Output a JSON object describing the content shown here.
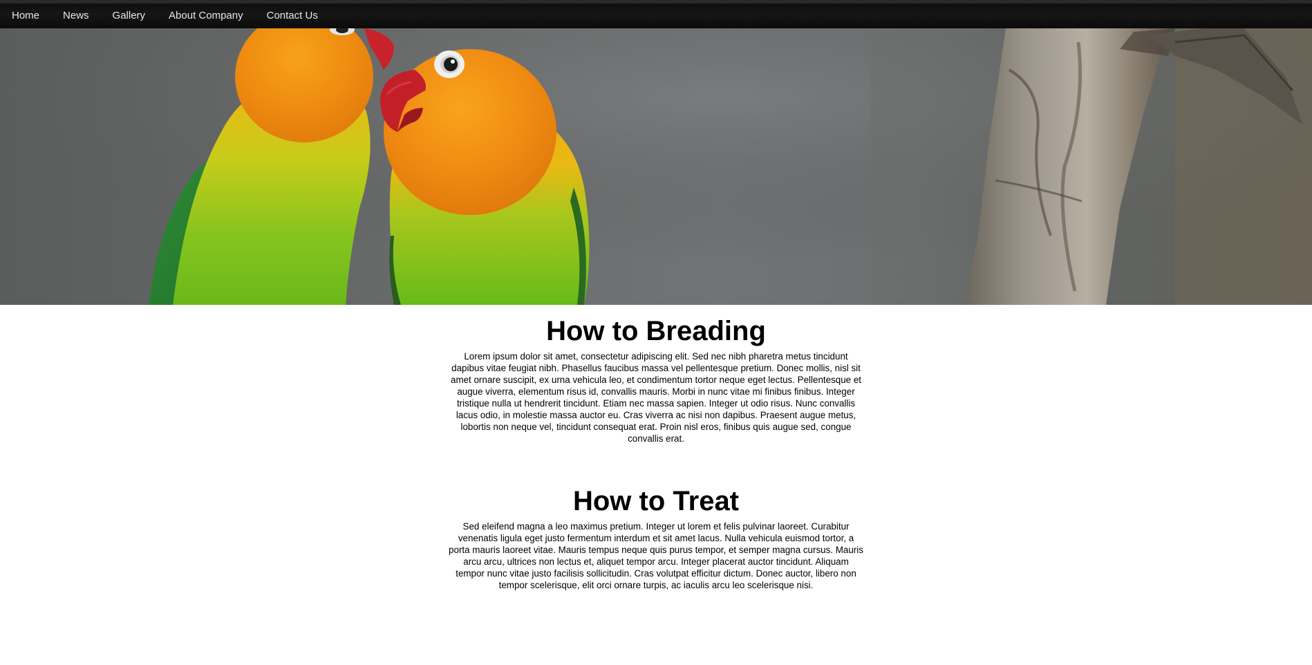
{
  "nav": {
    "items": [
      {
        "label": "Home"
      },
      {
        "label": "News"
      },
      {
        "label": "Gallery"
      },
      {
        "label": "About Company"
      },
      {
        "label": "Contact Us"
      }
    ]
  },
  "hero": {
    "image": "parrots-photo"
  },
  "sections": [
    {
      "title": "How to Breading",
      "body": "Lorem ipsum dolor sit amet, consectetur adipiscing elit. Sed nec nibh pharetra metus tincidunt dapibus vitae feugiat nibh. Phasellus faucibus massa vel pellentesque pretium. Donec mollis, nisl sit amet ornare suscipit, ex urna vehicula leo, et condimentum tortor neque eget lectus. Pellentesque et augue viverra, elementum risus id, convallis mauris. Morbi in nunc vitae mi finibus finibus. Integer tristique nulla ut hendrerit tincidunt. Etiam nec massa sapien. Integer ut odio risus. Nunc convallis lacus odio, in molestie massa auctor eu. Cras viverra ac nisi non dapibus. Praesent augue metus, lobortis non neque vel, tincidunt consequat erat. Proin nisl eros, finibus quis augue sed, congue convallis erat."
    },
    {
      "title": "How to Treat",
      "body": "Sed eleifend magna a leo maximus pretium. Integer ut lorem et felis pulvinar laoreet. Curabitur venenatis ligula eget justo fermentum interdum et sit amet lacus. Nulla vehicula euismod tortor, a porta mauris laoreet vitae. Mauris tempus neque quis purus tempor, et semper magna cursus. Mauris arcu arcu, ultrices non lectus et, aliquet tempor arcu. Integer placerat auctor tincidunt. Aliquam tempor nunc vitae justo facilisis sollicitudin. Cras volutpat efficitur dictum. Donec auctor, libero non tempor scelerisque, elit orci ornare turpis, ac iaculis arcu leo scelerisque nisi."
    }
  ],
  "colors": {
    "nav_bg": "#111111",
    "nav_text": "#e8e8e8",
    "parrot_orange": "#f08a12",
    "parrot_yellow": "#f5c20f",
    "parrot_green": "#6cc21b",
    "beak_red": "#c8232a"
  }
}
